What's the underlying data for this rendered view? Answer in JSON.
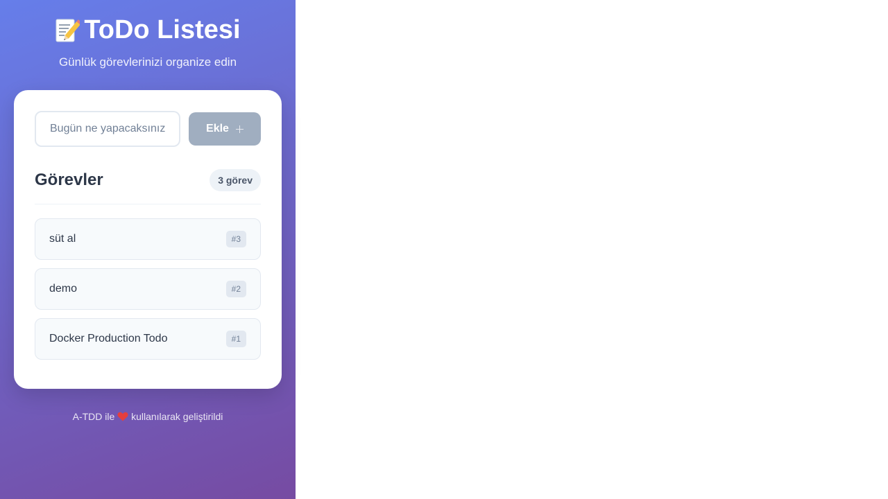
{
  "header": {
    "title": "ToDo Listesi",
    "title_icon": "memo-pencil-icon",
    "subtitle": "Günlük görevlerinizi organize edin"
  },
  "input": {
    "placeholder": "Bugün ne yapacaksınız?",
    "value": ""
  },
  "add_button": {
    "label": "Ekle",
    "icon": "plus-icon",
    "disabled": true
  },
  "tasks_section": {
    "title": "Görevler",
    "count_label": "3 görev"
  },
  "tasks": [
    {
      "text": "süt al",
      "id_label": "#3"
    },
    {
      "text": "demo",
      "id_label": "#2"
    },
    {
      "text": "Docker Production Todo",
      "id_label": "#1"
    }
  ],
  "footer": {
    "prefix": "A-TDD ile",
    "icon": "heart-icon",
    "suffix": "kullanılarak geliştirildi"
  },
  "colors": {
    "gradient_start": "#667eea",
    "gradient_end": "#764ba2",
    "button_disabled": "#a0aec0",
    "text_primary": "#2d3748",
    "heart": "#e53e3e"
  }
}
